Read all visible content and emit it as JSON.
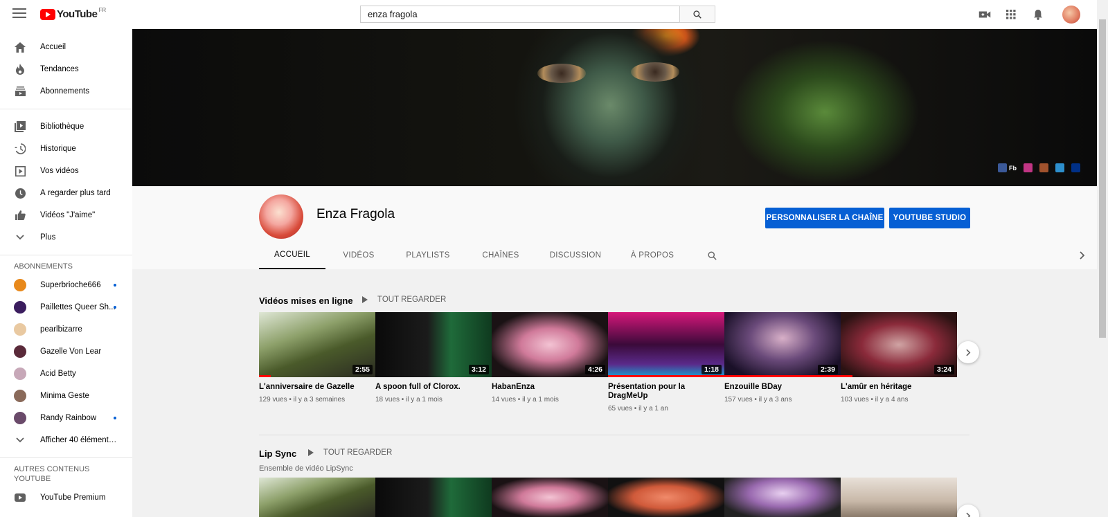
{
  "header": {
    "logo_text": "YouTube",
    "logo_country": "FR",
    "search_value": "enza fragola",
    "icons": [
      "video-camera-icon",
      "apps-grid-icon",
      "bell-icon",
      "account-avatar"
    ]
  },
  "sidebar": {
    "main": [
      {
        "label": "Accueil",
        "icon": "home-icon"
      },
      {
        "label": "Tendances",
        "icon": "flame-icon"
      },
      {
        "label": "Abonnements",
        "icon": "subscriptions-icon"
      }
    ],
    "library": [
      {
        "label": "Bibliothèque",
        "icon": "library-icon"
      },
      {
        "label": "Historique",
        "icon": "history-icon"
      },
      {
        "label": "Vos vidéos",
        "icon": "your-videos-icon"
      },
      {
        "label": "À regarder plus tard",
        "icon": "clock-icon"
      },
      {
        "label": "Vidéos \"J'aime\"",
        "icon": "thumbs-up-icon"
      },
      {
        "label": "Plus",
        "icon": "chevron-down-icon"
      }
    ],
    "subscriptions_title": "ABONNEMENTS",
    "subscriptions": [
      {
        "label": "Superbrioche666",
        "color": "#e8891b",
        "dot": true
      },
      {
        "label": "Paillettes Queer Sh...",
        "color": "#3b1d5e",
        "dot": true
      },
      {
        "label": "pearlbizarre",
        "color": "#e9c9a1",
        "dot": false
      },
      {
        "label": "Gazelle Von Lear",
        "color": "#5a2a3a",
        "dot": false
      },
      {
        "label": "Acid Betty",
        "color": "#c7a8b8",
        "dot": false
      },
      {
        "label": "Minima Geste",
        "color": "#8a6a5a",
        "dot": false
      },
      {
        "label": "Randy Rainbow",
        "color": "#6a4a6a",
        "dot": true
      }
    ],
    "show_more": "Afficher 40 éléments ...",
    "other_title_line1": "AUTRES CONTENUS",
    "other_title_line2": "YOUTUBE",
    "other": [
      {
        "label": "YouTube Premium",
        "icon": "youtube-premium-icon"
      }
    ]
  },
  "banner": {
    "links": [
      {
        "name": "facebook-link",
        "label": "Fb",
        "color": "#3b5998"
      },
      {
        "name": "instagram-link",
        "label": "",
        "color": "#c13584"
      },
      {
        "name": "profile-link",
        "label": "",
        "color": "#a0522d"
      },
      {
        "name": "telegram-link",
        "label": "",
        "color": "#2d8fcd"
      },
      {
        "name": "paypal-link",
        "label": "",
        "color": "#003087"
      }
    ]
  },
  "channel": {
    "name": "Enza Fragola",
    "customize_label": "PERSONNALISER LA CHAÎNE",
    "studio_label": "YOUTUBE STUDIO",
    "tabs": [
      "ACCUEIL",
      "VIDÉOS",
      "PLAYLISTS",
      "CHAÎNES",
      "DISCUSSION",
      "À PROPOS"
    ]
  },
  "rows": [
    {
      "title": "Vidéos mises en ligne",
      "see_all": "TOUT REGARDER",
      "videos": [
        {
          "title": "L'anniversaire de Gazelle",
          "meta": "129 vues • il y a 3 semaines",
          "duration": "2:55",
          "progress": 0.1
        },
        {
          "title": "A spoon full of Clorox.",
          "meta": "18 vues • il y a 1 mois",
          "duration": "3:12",
          "progress": 0
        },
        {
          "title": "HabanEnza",
          "meta": "14 vues • il y a 1 mois",
          "duration": "4:26",
          "progress": 0
        },
        {
          "title": "Présentation pour la DragMeUp",
          "meta": "65 vues • il y a 1 an",
          "duration": "1:18",
          "progress": 1.0
        },
        {
          "title": "Enzouille BDay",
          "meta": "157 vues • il y a 3 ans",
          "duration": "2:39",
          "progress": 1.0
        },
        {
          "title": "L'amûr en héritage",
          "meta": "103 vues • il y a 4 ans",
          "duration": "3:24",
          "progress": 0.1
        }
      ]
    },
    {
      "title": "Lip Sync",
      "see_all": "TOUT REGARDER",
      "description": "Ensemble de vidéo LipSync"
    }
  ]
}
